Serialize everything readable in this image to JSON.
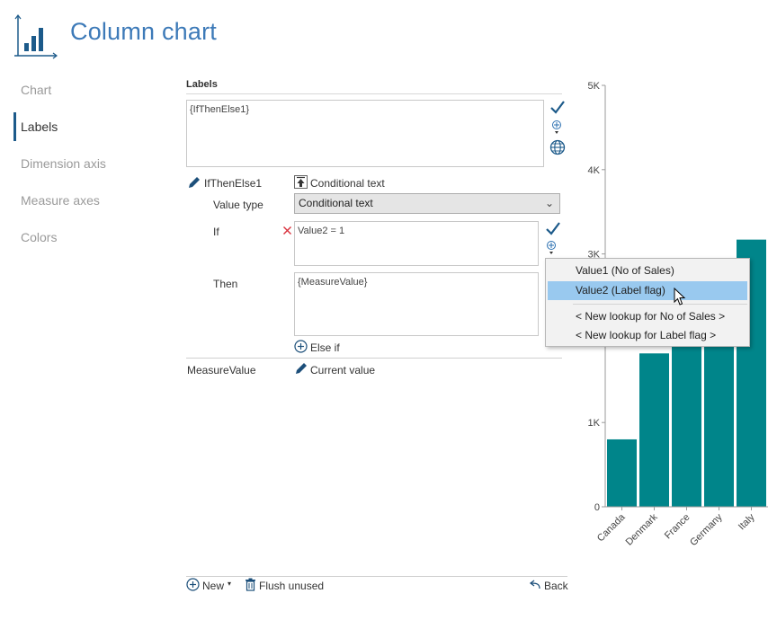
{
  "header": {
    "title": "Column chart"
  },
  "nav": {
    "items": [
      {
        "label": "Chart"
      },
      {
        "label": "Labels"
      },
      {
        "label": "Dimension axis"
      },
      {
        "label": "Measure axes"
      },
      {
        "label": "Colors"
      }
    ],
    "active": "Labels"
  },
  "labels_panel": {
    "section_title": "Labels",
    "expression": "{IfThenElse1}",
    "ifthenelse": {
      "name": "IfThenElse1",
      "type_button": "Conditional text",
      "value_type_label": "Value type",
      "value_type_selected": "Conditional text",
      "if_label": "If",
      "if_value": "Value2 = 1",
      "then_label": "Then",
      "then_value": "{MeasureValue}",
      "else_if_label": "Else if"
    },
    "measure_value": {
      "name": "MeasureValue",
      "type_button": "Current value"
    }
  },
  "dropdown": {
    "items": [
      {
        "label": "Value1 (No of Sales)"
      },
      {
        "label": "Value2 (Label flag)"
      }
    ],
    "lookups": [
      {
        "label": "< New lookup for No of Sales >"
      },
      {
        "label": "< New lookup for Label flag >"
      }
    ],
    "selected": "Value2 (Label flag)"
  },
  "footer": {
    "new_label": "New",
    "flush_label": "Flush unused",
    "back_label": "Back"
  },
  "colors": {
    "accent": "#3d7ab8",
    "bar": "#00858a",
    "selection": "#99c9ef",
    "check": "#1c5a8a"
  },
  "chart_data": {
    "type": "bar",
    "categories": [
      "Canada",
      "Denmark",
      "France",
      "Germany",
      "Italy"
    ],
    "values": [
      800,
      1820,
      1950,
      2450,
      3170
    ],
    "yticks": [
      "0",
      "1K",
      "2K",
      "3K",
      "4K",
      "5K"
    ],
    "ylim": [
      0,
      5000
    ],
    "visible_ytick_labels": [
      "0",
      "1K",
      "3K",
      "4K",
      "5K"
    ],
    "xlabel": "",
    "ylabel": ""
  }
}
